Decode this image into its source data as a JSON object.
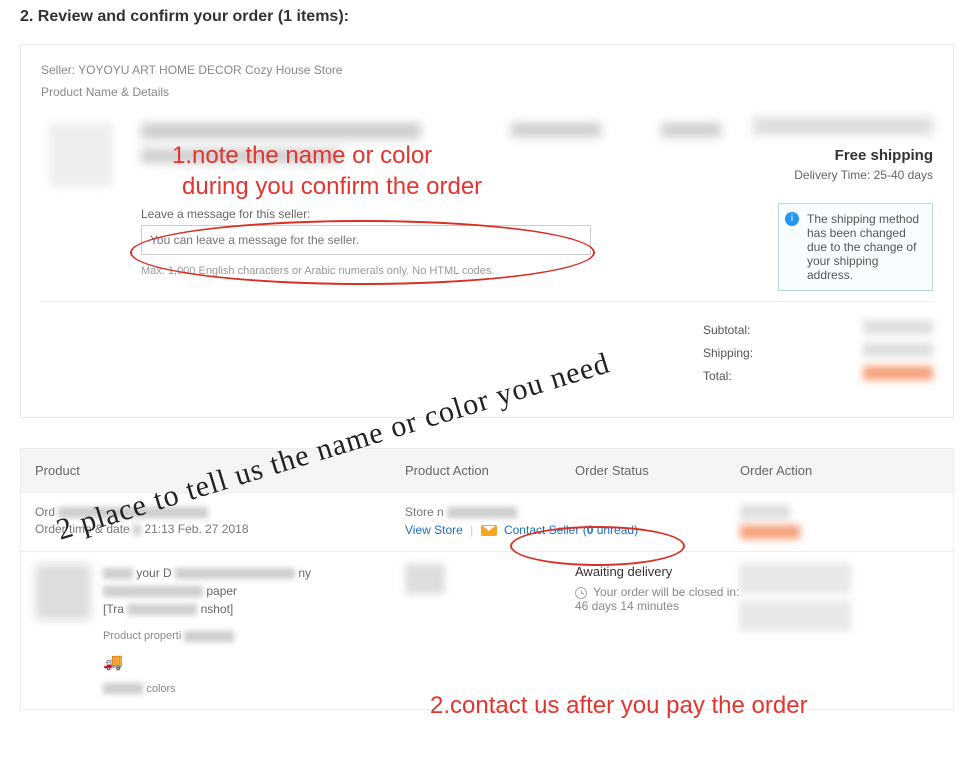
{
  "section_title": "2. Review and confirm your order (1 items):",
  "seller_label": "Seller: YOYOYU ART HOME DECOR Cozy House Store",
  "details_label": "Product Name & Details",
  "shipping": {
    "free_label": "Free shipping",
    "delivery_time_label": "Delivery Time:",
    "delivery_time_value": "25-40 days",
    "notice": "The shipping method has been changed due to the change of your shipping address."
  },
  "message": {
    "label": "Leave a message for this seller:",
    "placeholder": "You can leave a message for the seller.",
    "hint": "Max. 1,000 English characters or Arabic numerals only. No HTML codes."
  },
  "totals": {
    "subtotal": "Subtotal:",
    "shipping": "Shipping:",
    "total": "Total:"
  },
  "table": {
    "headers": {
      "product": "Product",
      "product_action": "Product Action",
      "order_status": "Order Status",
      "order_action": "Order Action"
    },
    "order": {
      "ord_prefix": "Ord",
      "time_prefix": "Order time & date",
      "time_value": "21:13 Feb. 27 2018"
    },
    "store": {
      "name_prefix": "Store n",
      "view_store": "View Store",
      "contact_seller": "Contact Seller",
      "unread_prefix": "(",
      "unread_count": "0",
      "unread_suffix": " unread)"
    },
    "detail": {
      "line1_prefix": "your D",
      "line1_suffix": "ny",
      "line2_suffix": "paper",
      "line3_prefix": "[Tra",
      "line3_suffix": "nshot]",
      "prop": "Product properti",
      "colors": "colors"
    },
    "status": {
      "awaiting": "Awaiting delivery",
      "close_prefix": "Your order will be closed in:",
      "close_value": "46 days 14 minutes"
    }
  },
  "annotations": {
    "note1_line1": "1.note the name or color",
    "note1_line2": "during you confirm the order",
    "note2": "2.contact us after you pay the order",
    "script": "2 place to tell us the name or color you need"
  }
}
